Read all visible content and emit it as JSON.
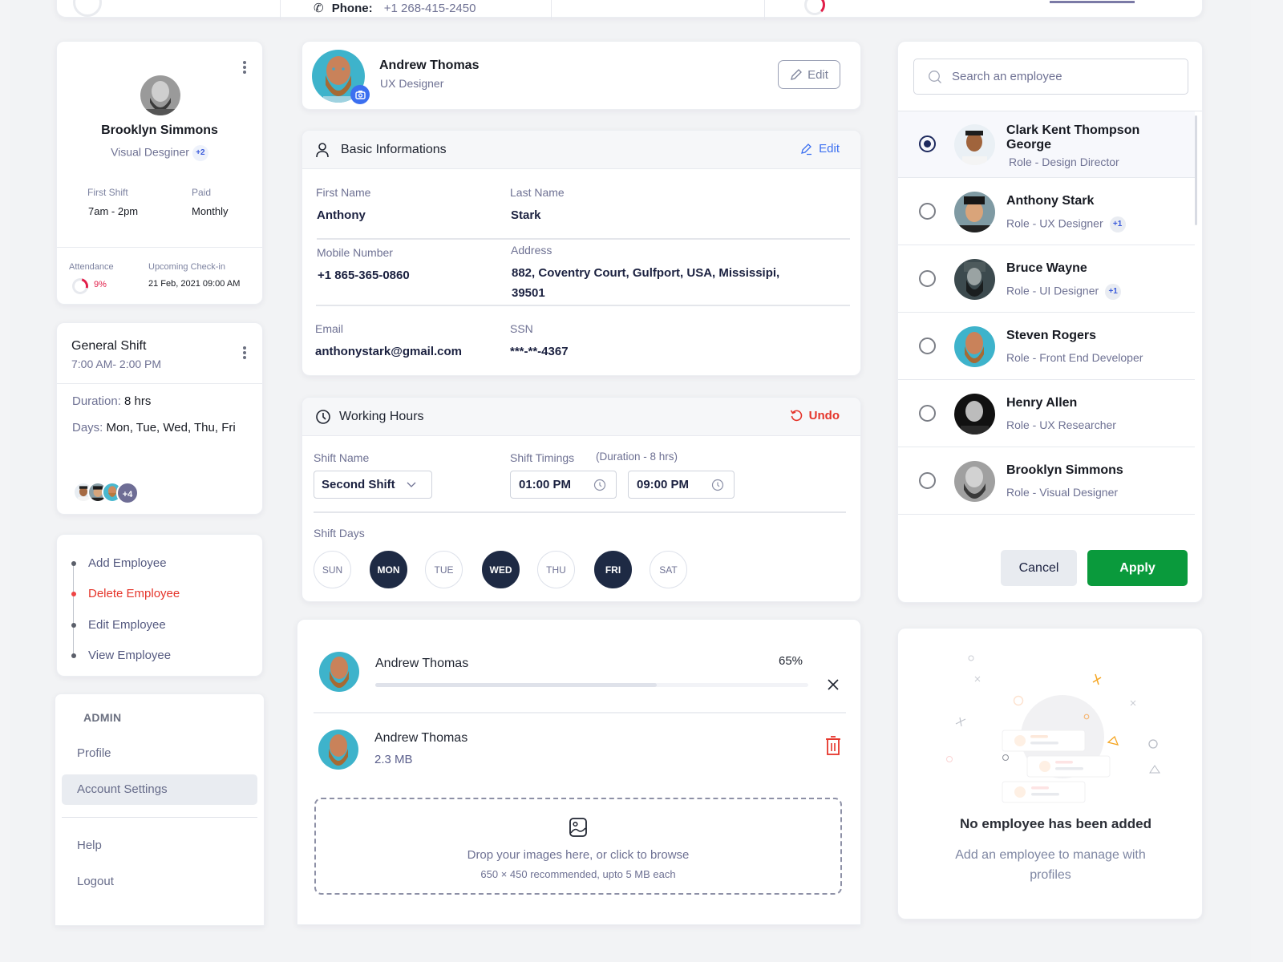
{
  "top_strip": {
    "phone_label": "Phone:",
    "phone_value": "+1 268-415-2450"
  },
  "profile_card": {
    "name": "Brooklyn Simmons",
    "role": "Visual Desginer",
    "role_extra": "+2",
    "shift_label": "First Shift",
    "shift_value": "7am - 2pm",
    "paid_label": "Paid",
    "paid_value": "Monthly",
    "attendance_label": "Attendance",
    "attendance_value": "9%",
    "attendance_fraction": 0.09,
    "checkin_label": "Upcoming Check-in",
    "checkin_value": "21 Feb, 2021 09:00 AM"
  },
  "shift_card": {
    "title": "General Shift",
    "time": "7:00 AM- 2:00 PM",
    "duration_label": "Duration:",
    "duration_value": "8 hrs",
    "days_label": "Days:",
    "days_value": "Mon, Tue, Wed, Thu, Fri",
    "more_members": "+4"
  },
  "timeline": {
    "items": [
      {
        "label": "Add Employee",
        "active": false
      },
      {
        "label": "Delete Employee",
        "active": true
      },
      {
        "label": "Edit Employee",
        "active": false
      },
      {
        "label": "View Employee",
        "active": false
      }
    ]
  },
  "admin_menu": {
    "heading": "ADMIN",
    "items": [
      {
        "label": "Profile",
        "active": false
      },
      {
        "label": "Account Settings",
        "active": true
      },
      {
        "label": "Help",
        "active": false
      },
      {
        "label": "Logout",
        "active": false
      }
    ]
  },
  "profile_header": {
    "name": "Andrew Thomas",
    "role": "UX Designer",
    "edit_label": "Edit"
  },
  "basic_info": {
    "title": "Basic Informations",
    "edit_label": "Edit",
    "fields": {
      "first_name": {
        "label": "First Name",
        "value": "Anthony"
      },
      "last_name": {
        "label": "Last Name",
        "value": "Stark"
      },
      "mobile": {
        "label": "Mobile Number",
        "value": "+1 865-365-0860"
      },
      "address": {
        "label": "Address",
        "value_line1": "882, Coventry Court, Gulfport, USA, Mississipi,",
        "value_line2": "39501"
      },
      "email": {
        "label": "Email",
        "value": "anthonystark@gmail.com"
      },
      "ssn": {
        "label": "SSN",
        "value": "***-**-4367"
      }
    }
  },
  "working_hours": {
    "title": "Working Hours",
    "undo_label": "Undo",
    "shift_name_label": "Shift Name",
    "shift_name_value": "Second Shift",
    "shift_timings_label": "Shift Timings",
    "duration_note": "(Duration - 8 hrs)",
    "start_time": "01:00 PM",
    "end_time": "09:00 PM",
    "shift_days_label": "Shift Days",
    "days": [
      {
        "label": "SUN",
        "selected": false
      },
      {
        "label": "MON",
        "selected": true
      },
      {
        "label": "TUE",
        "selected": false
      },
      {
        "label": "WED",
        "selected": true
      },
      {
        "label": "THU",
        "selected": false
      },
      {
        "label": "FRI",
        "selected": true
      },
      {
        "label": "SAT",
        "selected": false
      }
    ]
  },
  "upload": {
    "uploading": {
      "name": "Andrew Thomas",
      "progress_label": "65%",
      "progress": 0.65
    },
    "uploaded": {
      "name": "Andrew Thomas",
      "size": "2.3 MB"
    },
    "dropzone_main": "Drop your images here, or click to browse",
    "dropzone_sub": "650 × 450 recommended, upto 5 MB each"
  },
  "employee_picker": {
    "search_placeholder": "Search an employee",
    "employees": [
      {
        "name_line1": "Clark Kent Thompson",
        "name_line2": "George",
        "role": "Role - Design Director",
        "extra": "",
        "selected": true
      },
      {
        "name_line1": "Anthony Stark",
        "name_line2": "",
        "role": "Role - UX Designer",
        "extra": "+1",
        "selected": false
      },
      {
        "name_line1": "Bruce Wayne",
        "name_line2": "",
        "role": "Role - UI Designer",
        "extra": "+1",
        "selected": false
      },
      {
        "name_line1": "Steven Rogers",
        "name_line2": "",
        "role": "Role - Front End Developer",
        "extra": "",
        "selected": false
      },
      {
        "name_line1": "Henry Allen",
        "name_line2": "",
        "role": "Role - UX Researcher",
        "extra": "",
        "selected": false
      },
      {
        "name_line1": "Brooklyn Simmons",
        "name_line2": "",
        "role": "Role - Visual Designer",
        "extra": "",
        "selected": false
      }
    ],
    "cancel_label": "Cancel",
    "apply_label": "Apply"
  },
  "empty_state": {
    "title": "No employee has been added",
    "subtitle": "Add an employee to manage with profiles"
  },
  "colors": {
    "accent_blue": "#3b6ff0",
    "danger": "#e5342a",
    "success": "#0a9a3c",
    "navy": "#1e2a44"
  }
}
